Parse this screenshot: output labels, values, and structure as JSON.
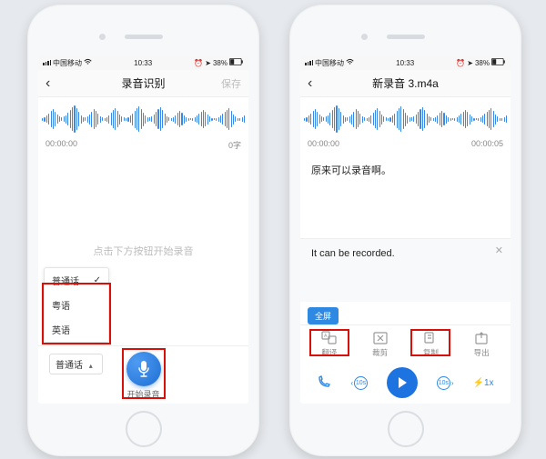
{
  "colors": {
    "accent": "#1d74e0",
    "waveform": "#3a87e6",
    "highlight": "#d9100a"
  },
  "status": {
    "carrier": "中国移动",
    "time": "10:33",
    "battery": "38%"
  },
  "left": {
    "nav": {
      "title": "录音识别",
      "right": "保存"
    },
    "time_start": "00:00:00",
    "word_count": "0字",
    "placeholder": "点击下方按钮开始录音",
    "lang_options": [
      "普通话",
      "粤语",
      "英语"
    ],
    "lang_selected": "普通话",
    "record_label": "开始录音"
  },
  "right": {
    "nav": {
      "title": "新录音 3.m4a",
      "right": ""
    },
    "time_start": "00:00:00",
    "time_end": "00:00:05",
    "transcript": "原来可以录音啊。",
    "translation": "It can be recorded.",
    "fullscreen": "全屏",
    "actions": [
      "翻译",
      "裁剪",
      "复制",
      "导出"
    ],
    "seek_back": "10s",
    "seek_fwd": "10s",
    "speed": "1x"
  }
}
